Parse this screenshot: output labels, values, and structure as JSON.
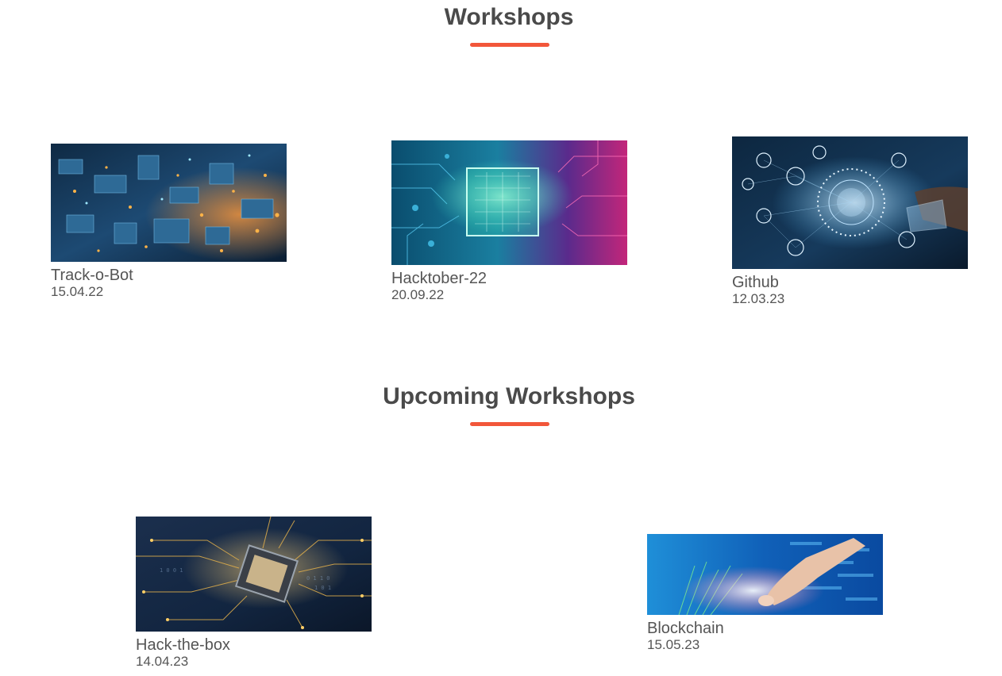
{
  "accent_color": "#f2563a",
  "past": {
    "title": "Workshops",
    "items": [
      {
        "name": "Track-o-Bot",
        "date": "15.04.22",
        "image": "circuit-city-image"
      },
      {
        "name": "Hacktober-22",
        "date": "20.09.22",
        "image": "processor-chip-image"
      },
      {
        "name": "Github",
        "date": "12.03.23",
        "image": "network-touch-image"
      }
    ]
  },
  "upcoming": {
    "title": "Upcoming Workshops",
    "items": [
      {
        "name": "Hack-the-box",
        "date": "14.04.23",
        "image": "golden-chip-image"
      },
      {
        "name": "Blockchain",
        "date": "15.05.23",
        "image": "fiber-optic-image"
      }
    ]
  }
}
